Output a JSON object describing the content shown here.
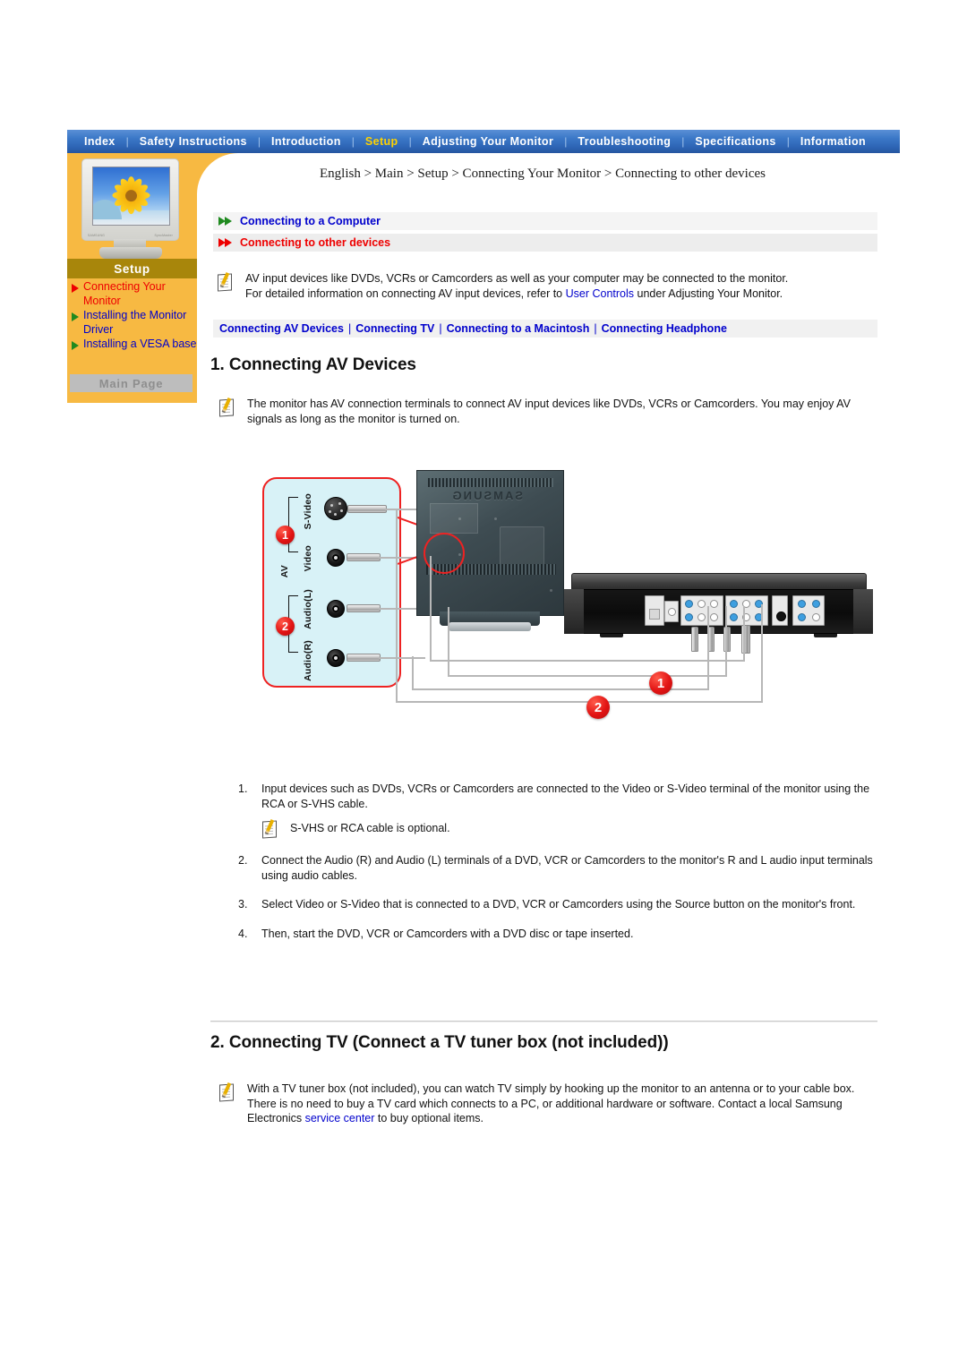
{
  "nav": {
    "items": [
      {
        "label": "Index",
        "active": false
      },
      {
        "label": "Safety Instructions",
        "active": false
      },
      {
        "label": "Introduction",
        "active": false
      },
      {
        "label": "Setup",
        "active": true
      },
      {
        "label": "Adjusting Your Monitor",
        "active": false
      },
      {
        "label": "Troubleshooting",
        "active": false
      },
      {
        "label": "Specifications",
        "active": false
      },
      {
        "label": "Information",
        "active": false
      }
    ],
    "separator": "|"
  },
  "sidebar": {
    "section_label": "Setup",
    "links": [
      {
        "label": "Connecting Your Monitor",
        "current": true
      },
      {
        "label": "Installing the Monitor Driver",
        "current": false
      },
      {
        "label": "Installing a VESA base",
        "current": false
      }
    ],
    "main_page_button": "Main Page"
  },
  "breadcrumb": "English > Main > Setup > Connecting Your Monitor > Connecting to other devices",
  "topics": [
    {
      "label": "Connecting to a Computer",
      "state": "inactive"
    },
    {
      "label": "Connecting to other devices",
      "state": "active"
    }
  ],
  "intro_note": {
    "line1": "AV input devices like DVDs, VCRs or Camcorders as well as your computer may be connected to the monitor.",
    "line2_before": "For detailed information on connecting AV input devices, refer to ",
    "link": "User Controls",
    "line2_after": " under Adjusting Your Monitor."
  },
  "subnav": {
    "links": [
      "Connecting AV Devices",
      "Connecting TV",
      "Connecting to a Macintosh",
      "Connecting Headphone"
    ],
    "separator": "|"
  },
  "section1": {
    "heading": "1. Connecting AV Devices",
    "note": "The monitor has AV connection terminals to connect AV input devices like DVDs, VCRs or Camcorders. You may enjoy AV signals as long as the monitor is turned on.",
    "steps": [
      {
        "num": "1.",
        "text": "Input devices such as DVDs, VCRs or Camcorders are connected to the Video or S-Video terminal of the monitor using the RCA or S-VHS cable."
      },
      {
        "num": "2.",
        "text": "Connect the Audio (R) and Audio (L) terminals of a DVD, VCR or Camcorders to the monitor's R and L audio input terminals using audio cables."
      },
      {
        "num": "3.",
        "text": "Select Video or S-Video that is connected to a DVD, VCR or Camcorders using the Source button on the monitor's front."
      },
      {
        "num": "4.",
        "text": "Then, start the DVD, VCR or Camcorders with a DVD disc or tape inserted."
      }
    ],
    "inline_note": "S-VHS or RCA cable is optional."
  },
  "section2": {
    "heading": "2. Connecting TV (Connect a TV tuner box (not included))",
    "note_before": "With a TV tuner box (not included), you can watch TV simply by hooking up the monitor to an antenna or to your cable box. There is no need to buy a TV card which connects to a PC, or additional hardware or software. Contact a local Samsung Electronics ",
    "note_link": "service center",
    "note_after": " to buy optional items."
  },
  "diagram": {
    "panel_labels": {
      "group": "AV",
      "svideo": "S-Video",
      "video": "Video",
      "audio_l": "Audio(L)",
      "audio_r": "Audio(R)"
    },
    "badges": {
      "one": "1",
      "two": "2"
    },
    "monitor_brand": "SAMSUNG"
  },
  "monitor_thumb": {
    "label_left": "SAMSUNG",
    "label_right": "SyncMaster"
  },
  "colors": {
    "nav_blue": "#2d64b4",
    "nav_active": "#ffd200",
    "sidebar_orange": "#f7b942",
    "setup_bar": "#a8860b",
    "link_blue": "#0000cc",
    "link_red": "#ee0000",
    "badge_red": "#e21414",
    "panel_cyan": "#d8f2f7"
  }
}
